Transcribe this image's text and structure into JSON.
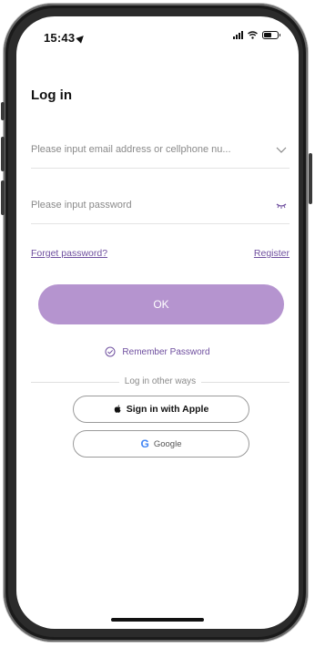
{
  "status_bar": {
    "time": "15:43",
    "battery_level": 0.55
  },
  "login": {
    "title": "Log in",
    "email_placeholder": "Please input email address or cellphone nu...",
    "password_placeholder": "Please input password",
    "forget_password": "Forget password?",
    "register": "Register",
    "ok_label": "OK",
    "remember_password": "Remember Password",
    "other_ways": "Log in other ways",
    "apple_label": "Sign in with Apple",
    "google_label": "Google"
  },
  "colors": {
    "accent": "#6f4f9f",
    "button": "#b594cf"
  }
}
